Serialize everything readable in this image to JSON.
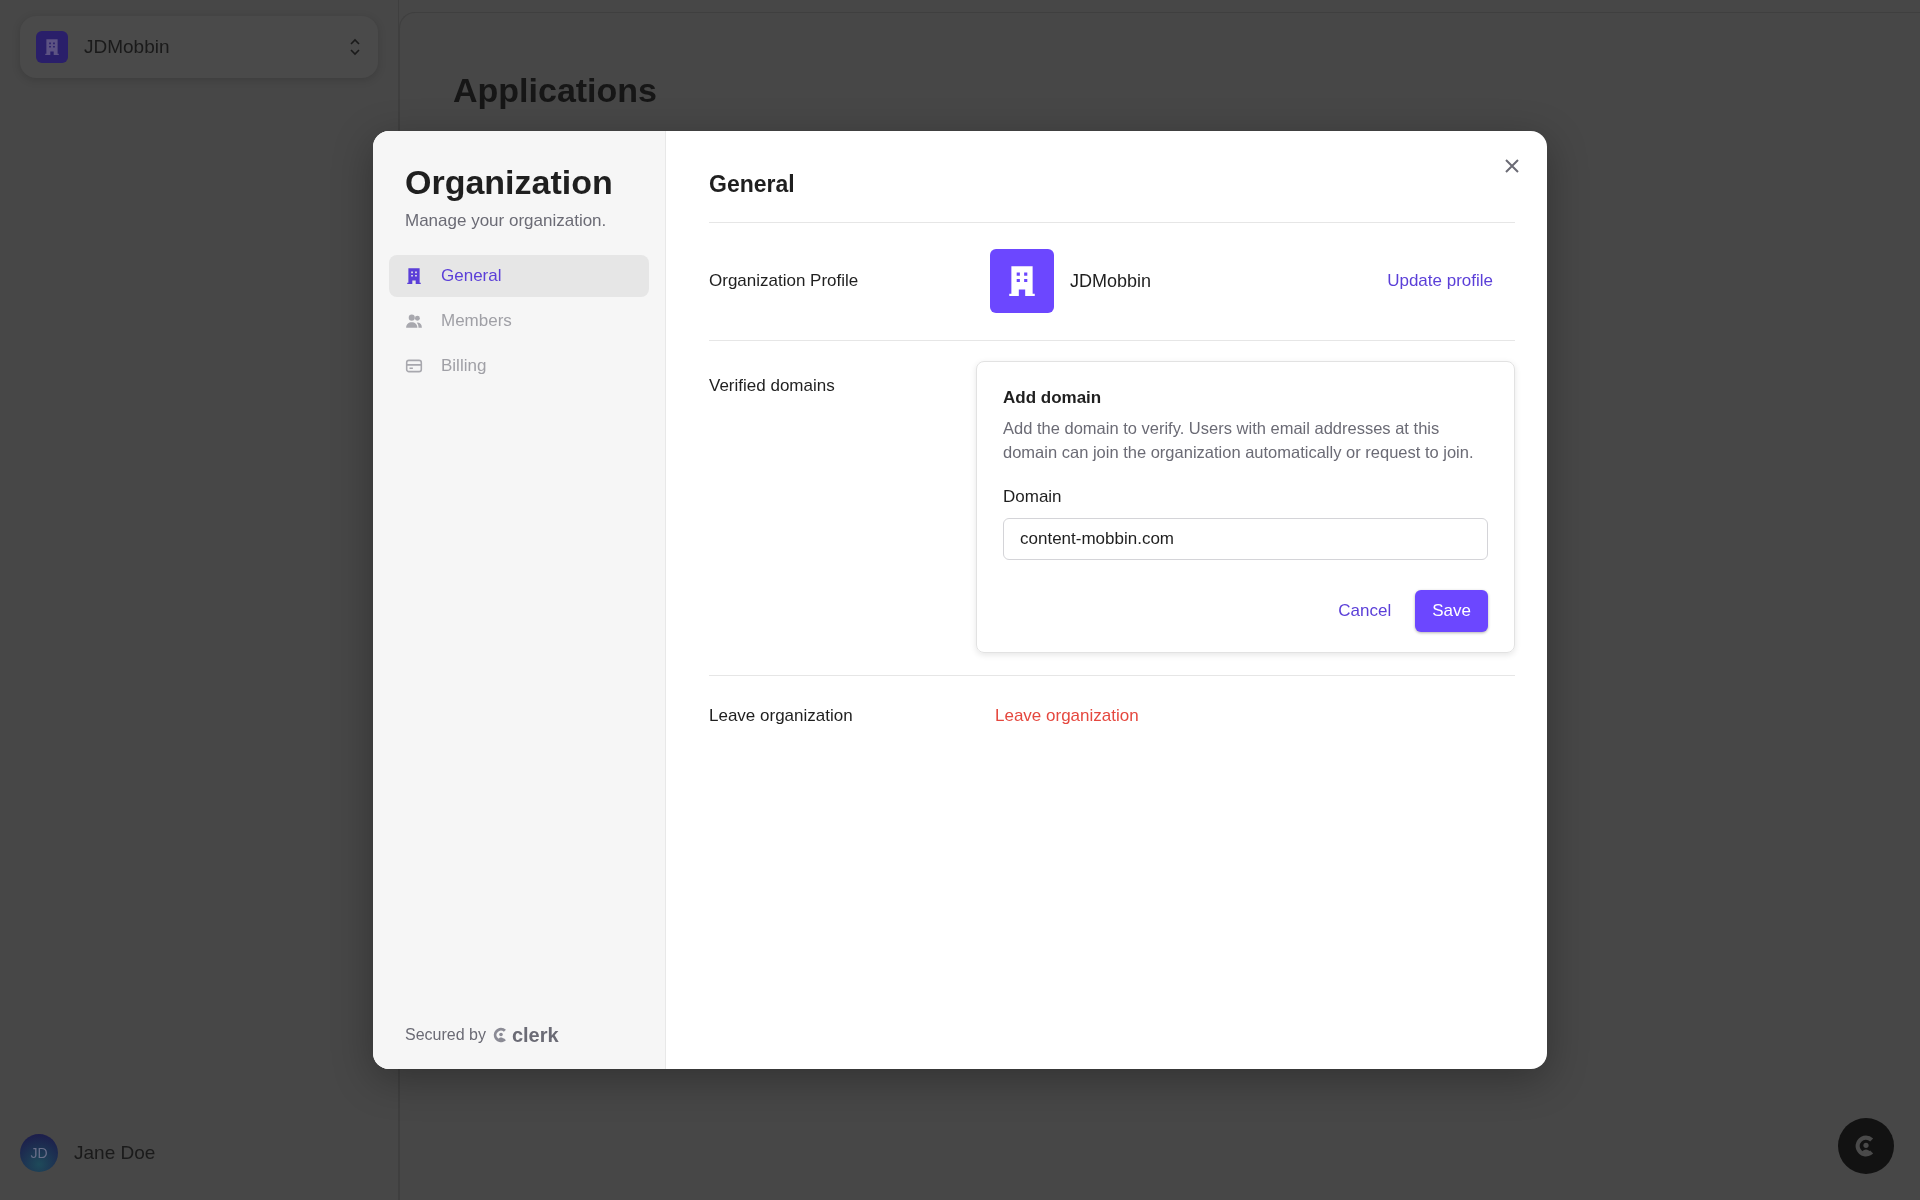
{
  "app": {
    "org_switcher": {
      "name": "JDMobbin"
    },
    "page_title": "Applications",
    "user": {
      "initials": "JD",
      "name": "Jane Doe"
    }
  },
  "dialog": {
    "title": "Organization",
    "subtitle": "Manage your organization.",
    "nav": [
      {
        "label": "General",
        "selected": true,
        "kind": "building"
      },
      {
        "label": "Members",
        "selected": false,
        "kind": "people"
      },
      {
        "label": "Billing",
        "selected": false,
        "kind": "card"
      }
    ],
    "footer": {
      "text": "Secured by",
      "brand": "clerk"
    },
    "section_title": "General",
    "profile": {
      "label": "Organization Profile",
      "name": "JDMobbin",
      "action": "Update profile"
    },
    "domains": {
      "label": "Verified domains",
      "form": {
        "title": "Add domain",
        "description": "Add the domain to verify. Users with email addresses at this domain can join the organization automatically or request to join.",
        "field_label": "Domain",
        "value": "content-mobbin.com",
        "buttons": [
          {
            "label": "Cancel",
            "kind": "link"
          },
          {
            "label": "Save",
            "kind": "primary"
          }
        ]
      }
    },
    "leave": {
      "label": "Leave organization",
      "action": "Leave organization"
    }
  }
}
